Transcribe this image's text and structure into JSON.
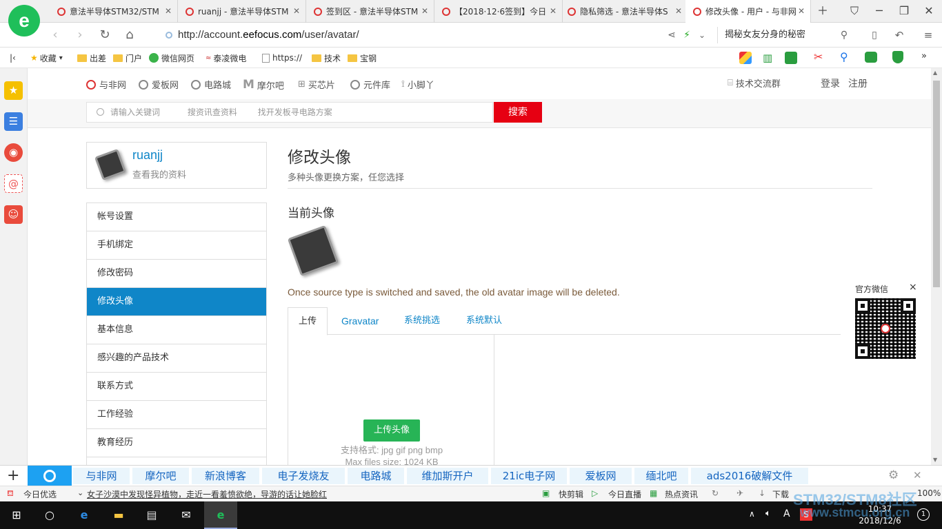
{
  "browser": {
    "tabs": [
      {
        "label": "意法半导体STM32/STM",
        "active": false
      },
      {
        "label": "ruanjj - 意法半导体STM",
        "active": false
      },
      {
        "label": "签到区 - 意法半导体STM",
        "active": false
      },
      {
        "label": "【2018·12·6签到】今日",
        "active": false
      },
      {
        "label": "隐私筛选 - 意法半导体S",
        "active": false
      },
      {
        "label": "修改头像 - 用户 - 与非网",
        "active": true
      }
    ],
    "url_prefix": "http://account.",
    "url_host": "eefocus.com",
    "url_path": "/user/avatar/",
    "search_hint": "揭秘女友分身的秘密",
    "bookmarks": [
      "收藏",
      "出差",
      "门户",
      "微信网页",
      "泰凌微电",
      "https://",
      "技术",
      "宝钢"
    ]
  },
  "site": {
    "topnav": [
      "与非网",
      "爱板网",
      "电路城",
      "摩尔吧",
      "买芯片",
      "元件库",
      "小脚丫"
    ],
    "group_link": "技术交流群",
    "login": "登录",
    "register": "注册",
    "search_placeholder": "请输入关键词",
    "search_hint1": "搜资讯查资料",
    "search_hint2": "找开发板寻电路方案",
    "search_button": "搜索"
  },
  "profile": {
    "username": "ruanjj",
    "view_link": "查看我的资料"
  },
  "menu": [
    "帐号设置",
    "手机绑定",
    "修改密码",
    "修改头像",
    "基本信息",
    "感兴趣的产品技术",
    "联系方式",
    "工作经验",
    "教育经历"
  ],
  "menu_active": "修改头像",
  "content": {
    "title": "修改头像",
    "subtitle": "多种头像更换方案，任您选择",
    "current_label": "当前头像",
    "note": "Once source type is switched and saved, the old avatar image will be deleted.",
    "tabs": [
      "上传",
      "Gravatar",
      "系统挑选",
      "系统默认"
    ],
    "upload_button": "上传头像",
    "formats": "支持格式:  jpg gif png bmp",
    "max_size": "Max files size: 1024 KB"
  },
  "qr": {
    "title": "官方微信",
    "close": "×"
  },
  "quicklinks": [
    "与非网",
    "摩尔吧",
    "新浪博客",
    "电子发烧友",
    "电路城",
    "维加斯开户",
    "21ic电子网",
    "爱板网",
    "缅北吧",
    "ads2016破解文件"
  ],
  "statusbar": {
    "left": "今日优选",
    "headline": "女子沙漠中发现怪异植物，走近一看羞愤欲绝，导游的话让她脸红",
    "items": [
      "快剪辑",
      "今日直播",
      "热点资讯",
      "下载"
    ],
    "zoom": "100%"
  },
  "taskbar": {
    "time": "10:37",
    "date": "2018/12/6",
    "ime": "A"
  },
  "watermark": {
    "line1": "STM32/STM8社区",
    "line2": "www.stmcu.org.cn"
  },
  "colors": {
    "accent_blue": "#0f86c8",
    "search_red": "#e60012",
    "upload_green": "#27b456",
    "browser_green": "#1fbf5a"
  }
}
